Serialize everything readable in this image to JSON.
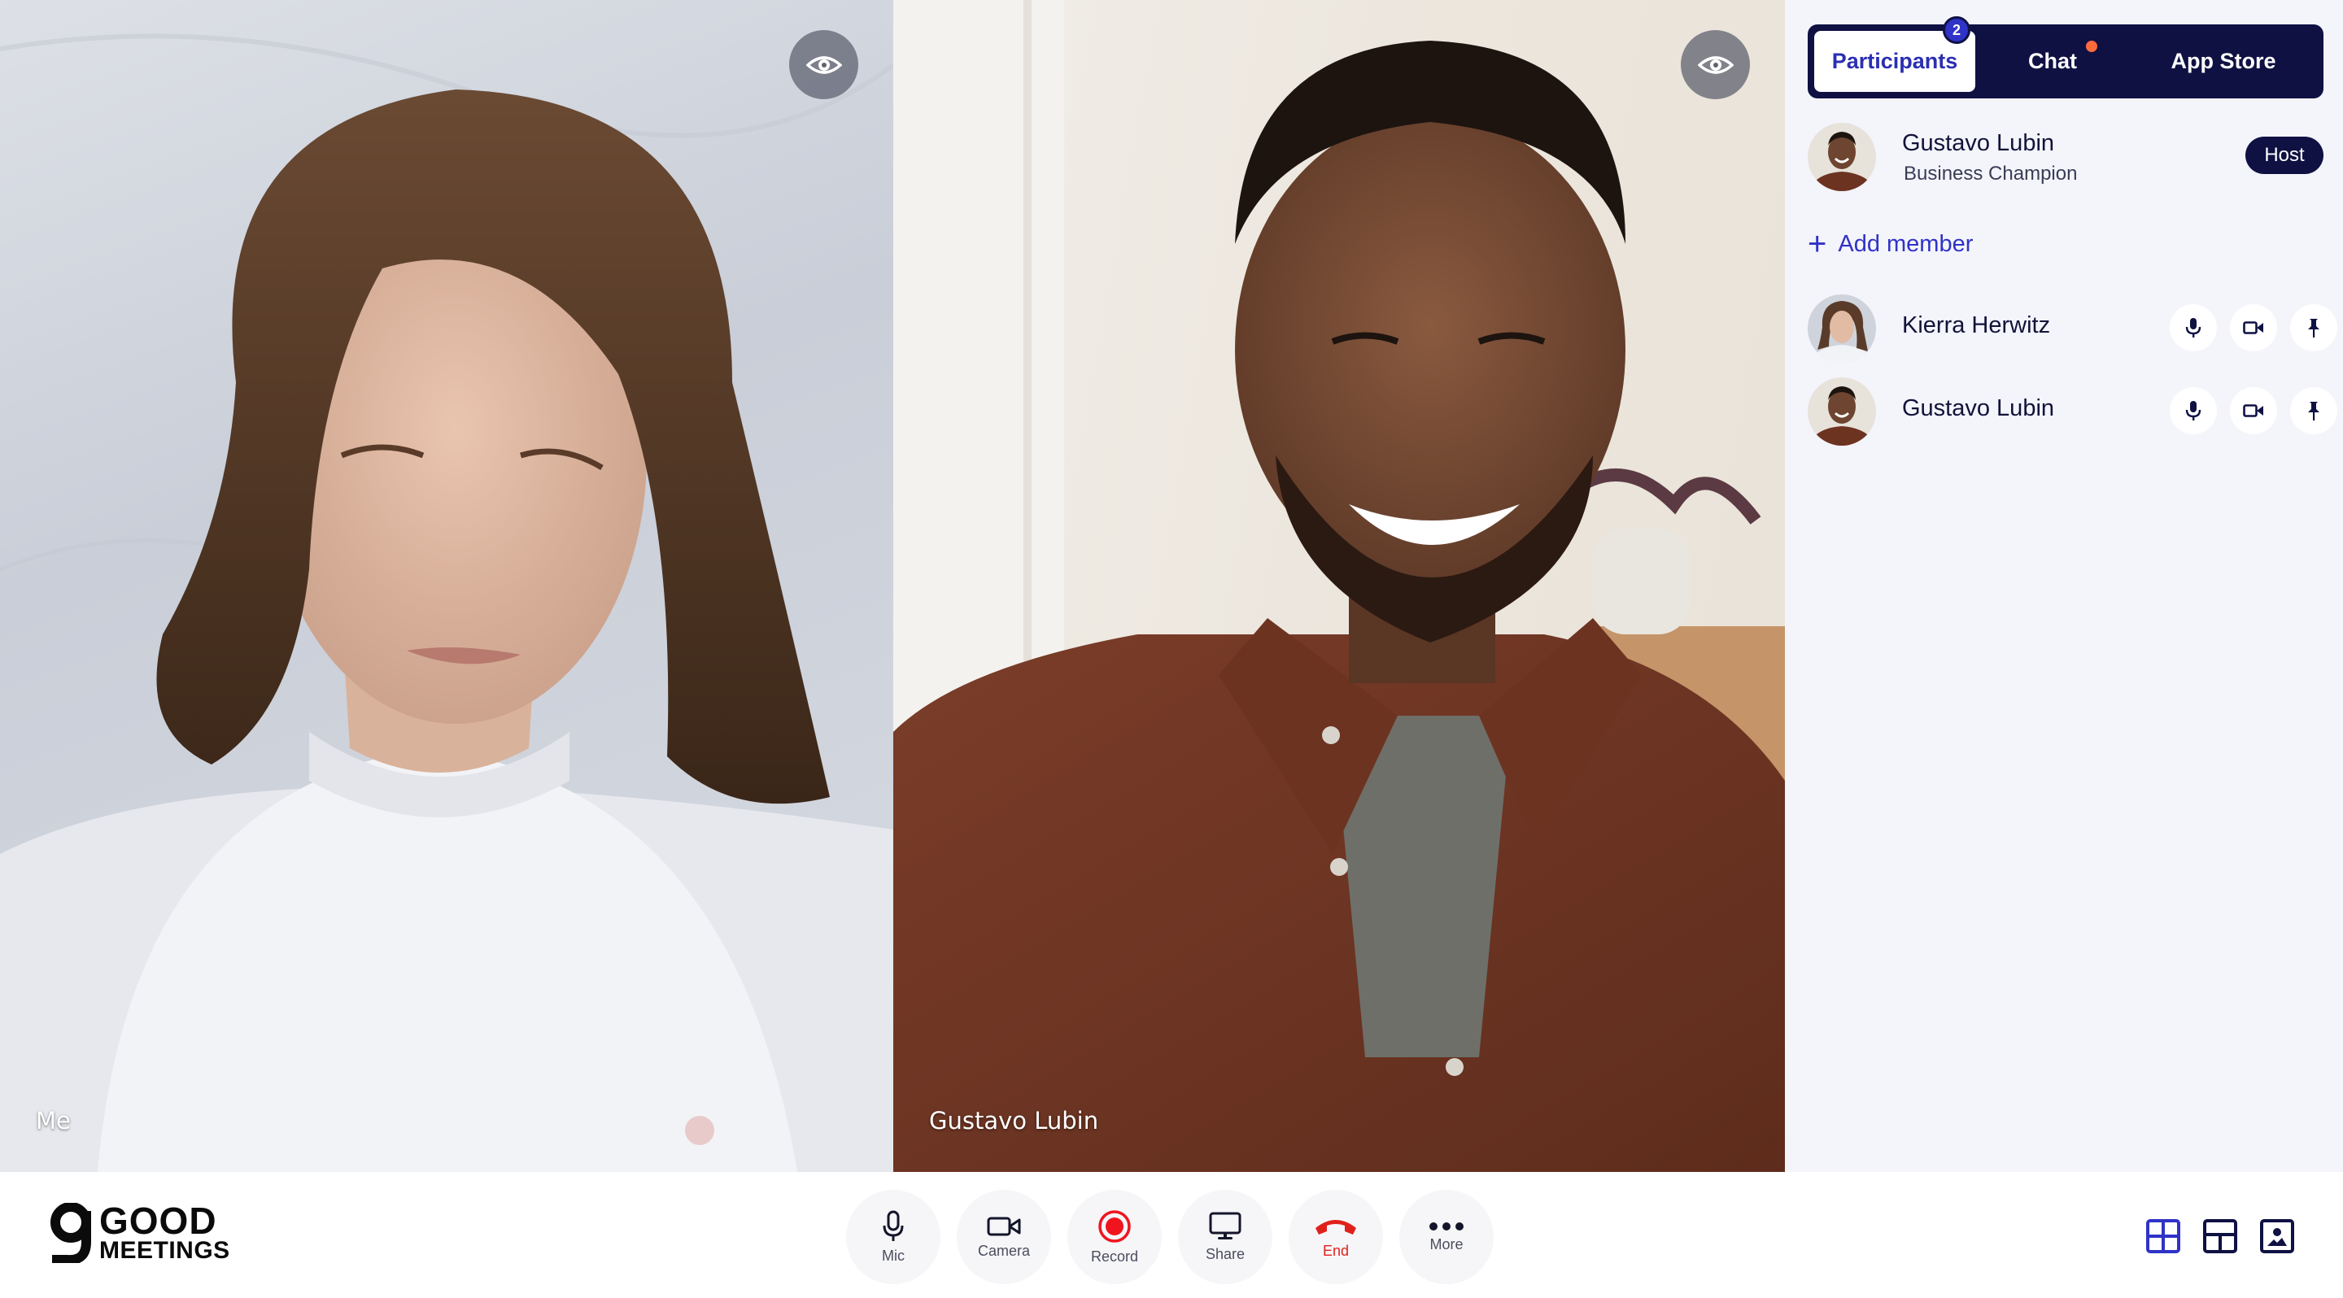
{
  "tiles": {
    "me": {
      "label": "Me"
    },
    "remote": {
      "label": "Gustavo Lubin"
    }
  },
  "panel": {
    "tabs": [
      {
        "label": "Participants",
        "badge": "2",
        "active": true
      },
      {
        "label": "Chat",
        "has_unread_dot": true
      },
      {
        "label": "App Store"
      }
    ],
    "host": {
      "name": "Gustavo Lubin",
      "role": "Business Champion",
      "badge": "Host"
    },
    "add_member_label": "Add member",
    "participants": [
      {
        "name": "Kierra Herwitz",
        "controls": [
          "mic-icon",
          "camera-icon",
          "pin-icon"
        ]
      },
      {
        "name": "Gustavo Lubin",
        "controls": [
          "mic-icon",
          "camera-icon",
          "pin-icon"
        ]
      }
    ]
  },
  "toolbar": {
    "logo": {
      "line1": "GOOD",
      "line2": "MEETINGS"
    },
    "buttons": [
      {
        "label": "Mic",
        "icon": "mic-icon"
      },
      {
        "label": "Camera",
        "icon": "camera-icon"
      },
      {
        "label": "Record",
        "icon": "record-icon"
      },
      {
        "label": "Share",
        "icon": "screen-share-icon"
      },
      {
        "label": "End",
        "icon": "end-call-icon"
      },
      {
        "label": "More",
        "icon": "more-icon"
      }
    ],
    "layout_buttons": [
      "grid-layout-icon",
      "split-layout-icon",
      "focus-layout-icon"
    ]
  },
  "colors": {
    "brand_navy": "#0f1143",
    "accent_blue": "#2f33c6",
    "end_red": "#e0211b",
    "record_red": "#f0141e",
    "notification_orange": "#ff6a3d",
    "panel_bg": "#f4f4fb"
  }
}
